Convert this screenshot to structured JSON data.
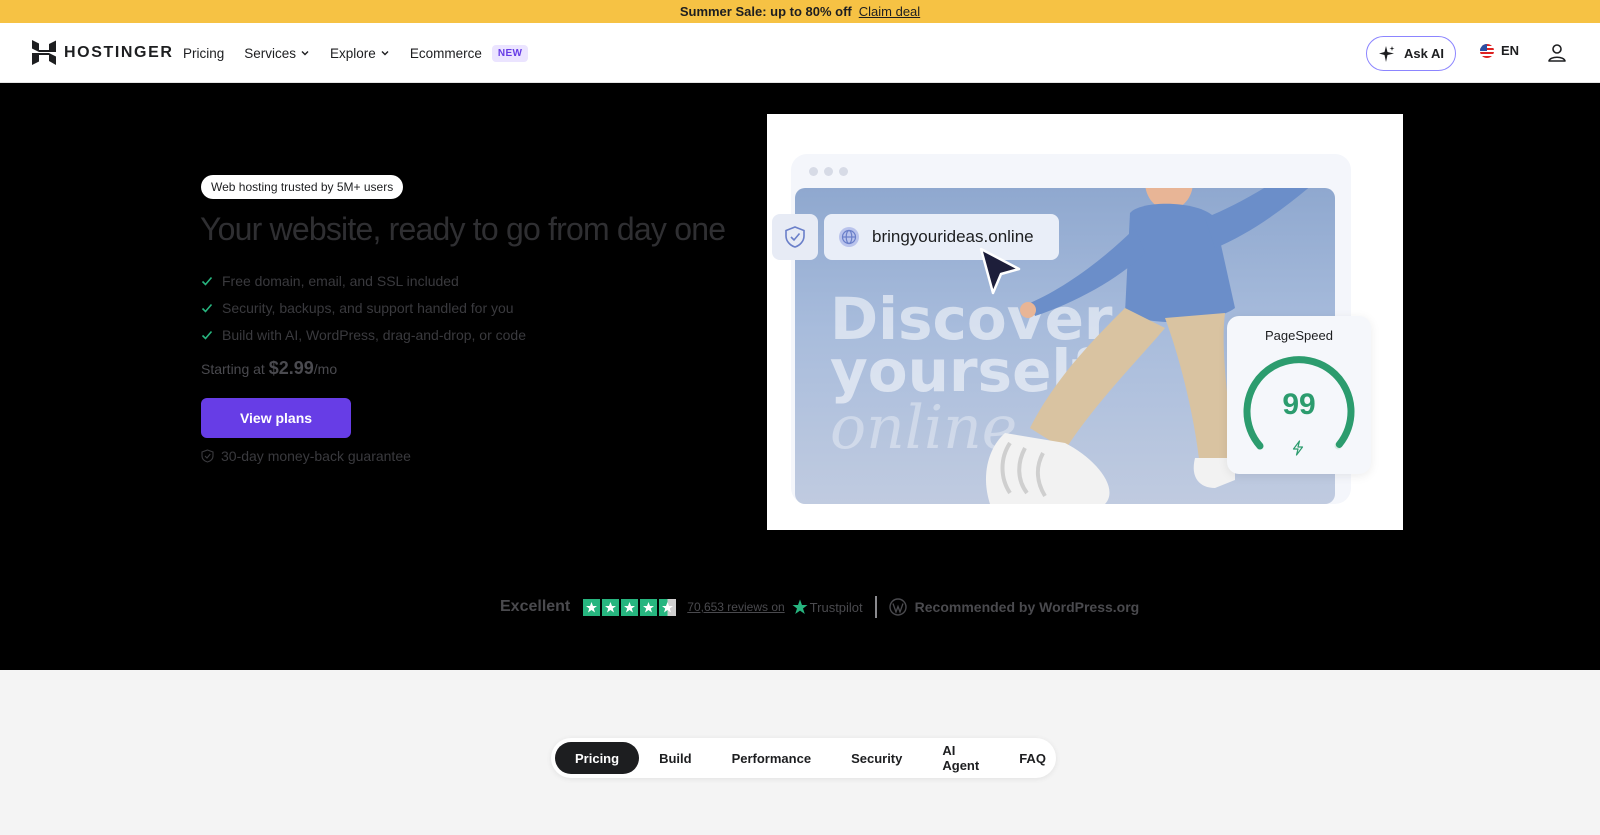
{
  "promo": {
    "text": "Summer Sale: up to 80% off",
    "link": "Claim deal"
  },
  "header": {
    "brand": "HOSTINGER",
    "nav": [
      {
        "label": "Pricing"
      },
      {
        "label": "Services"
      },
      {
        "label": "Explore"
      },
      {
        "label": "Ecommerce",
        "badge": "NEW"
      }
    ],
    "ask_ai": "Ask AI",
    "language": "EN"
  },
  "hero": {
    "trust_pill": "Web hosting trusted by 5M+ users",
    "title": "Your website, ready to go from day one",
    "features": [
      "Free domain, email, and SSL included",
      "Security, backups, and support handled for you",
      "Build with AI, WordPress, drag-and-drop, or code"
    ],
    "price_prefix": "Starting at",
    "price": "$2.99",
    "price_suffix": "/mo",
    "cta": "View plans",
    "guarantee": "30-day money-back guarantee",
    "image": {
      "domain": "bringyourideas.online",
      "headline_line1": "Discover",
      "headline_line2": "yourself",
      "headline_line3": "online",
      "pagespeed_label": "PageSpeed",
      "pagespeed_score": "99",
      "pagespeed_value": 99
    }
  },
  "trust": {
    "rating_word": "Excellent",
    "stars": 4.5,
    "reviews": "70,653 reviews on",
    "trustpilot": "Trustpilot",
    "wordpress": "Recommended by WordPress.org"
  },
  "tabs": [
    {
      "label": "Pricing",
      "active": true
    },
    {
      "label": "Build"
    },
    {
      "label": "Performance"
    },
    {
      "label": "Security"
    },
    {
      "label": "AI Agent"
    },
    {
      "label": "FAQ"
    }
  ],
  "colors": {
    "brand_purple": "#673de6",
    "promo_yellow": "#f6c244",
    "score_green": "#2c9c6e",
    "trustpilot_green": "#27b57f"
  }
}
